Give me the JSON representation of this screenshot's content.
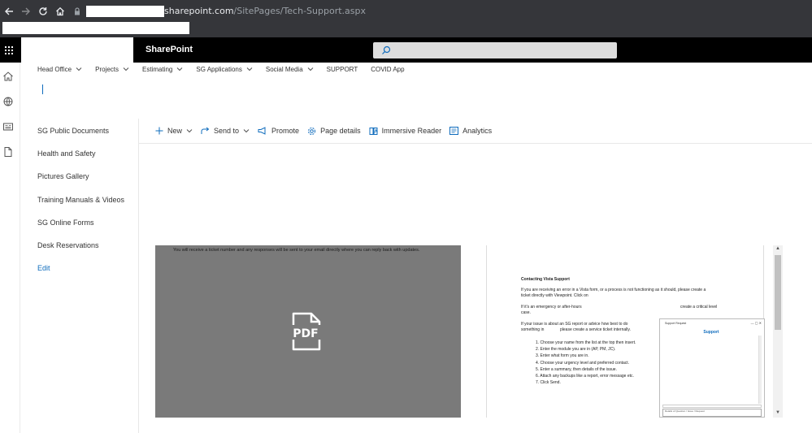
{
  "browser": {
    "url_host": "sharepoint.com",
    "url_path": "/SitePages/Tech-Support.aspx"
  },
  "suitebar": {
    "title": "SharePoint"
  },
  "top_nav": {
    "items": [
      {
        "label": "Head Office",
        "has_chevron": true
      },
      {
        "label": "Projects",
        "has_chevron": true
      },
      {
        "label": "Estimating",
        "has_chevron": true
      },
      {
        "label": "SG Applications",
        "has_chevron": true
      },
      {
        "label": "Social Media",
        "has_chevron": true
      },
      {
        "label": "SUPPORT",
        "has_chevron": false
      },
      {
        "label": "COVID App",
        "has_chevron": false
      }
    ]
  },
  "left_nav": {
    "items": [
      "SG Public Documents",
      "Health and Safety",
      "Pictures Gallery",
      "Training Manuals & Videos",
      "SG Online Forms",
      "Desk Reservations"
    ],
    "edit_label": "Edit"
  },
  "command_bar": {
    "new_label": "New",
    "send_to_label": "Send to",
    "promote_label": "Promote",
    "page_details_label": "Page details",
    "immersive_reader_label": "Immersive Reader",
    "analytics_label": "Analytics"
  },
  "pdf_viewer": {
    "text": "You will receive a ticket number and any responses will be sent to your email directly where you can reply back with updates.",
    "icon_label": "PDF"
  },
  "doc_viewer": {
    "heading": "Contacting Vista Support",
    "para1_line1": "If you are receiving an error in a Vista form, or a process is not functioning as it should, please create a",
    "para1_line2": "ticket directly with Viewpoint. Click on",
    "para2_line1a": "If it's an emergency or after-hours",
    "para2_line1b": "create a critical level",
    "para2_line2": "case.",
    "para3_line1": "If your issue is about an SG report or advice how best to do",
    "para3_line2a": "something in",
    "para3_line2b": "please create a service ticket internally.",
    "steps": [
      "1.    Choose your name from the list at the top then insert.",
      "2.    Enter the module you are in (AP, PM, JC).",
      "3.    Enter what form you are in.",
      "4.    Choose your urgency level and preferred contact.",
      "5.    Enter a summary, then details of the issue.",
      "6.    Attach any backups like a report, error message etc.",
      "7.    Click Send."
    ],
    "popup_title": "Support Request",
    "popup_heading": "Support",
    "popup_controls": "—   ▢   ✕",
    "popup_field_label": "Details of Question / Issue / Request"
  }
}
